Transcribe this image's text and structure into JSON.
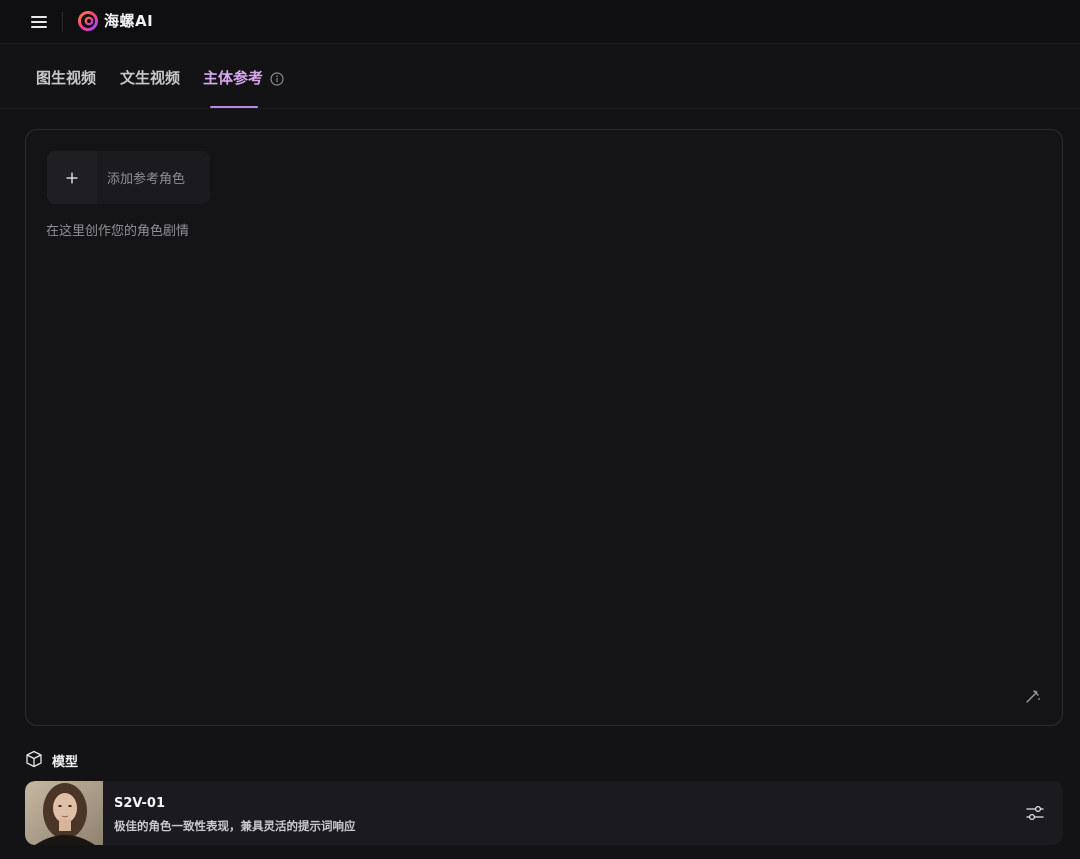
{
  "header": {
    "brand": "海螺AI",
    "icons": {
      "menu": "hamburger-menu-icon",
      "logo": "hailuo-logo-icon"
    }
  },
  "tabs": [
    {
      "label": "图生视频",
      "active": false
    },
    {
      "label": "文生视频",
      "active": false
    },
    {
      "label": "主体参考",
      "active": true
    }
  ],
  "colors": {
    "accent": "#d7a8f0",
    "underline": "#b98be0",
    "background": "#131316"
  },
  "composer": {
    "add_reference_label": "添加参考角色",
    "add_reference_icon": "plus-icon",
    "prompt_placeholder": "在这里创作您的角色剧情",
    "magic_icon": "magic-wand-icon"
  },
  "model_section": {
    "title": "模型",
    "icon": "cube-icon",
    "selected": {
      "name": "S2V-01",
      "description": "极佳的角色一致性表现，兼具灵活的提示词响应",
      "settings_icon": "sliders-icon"
    }
  }
}
